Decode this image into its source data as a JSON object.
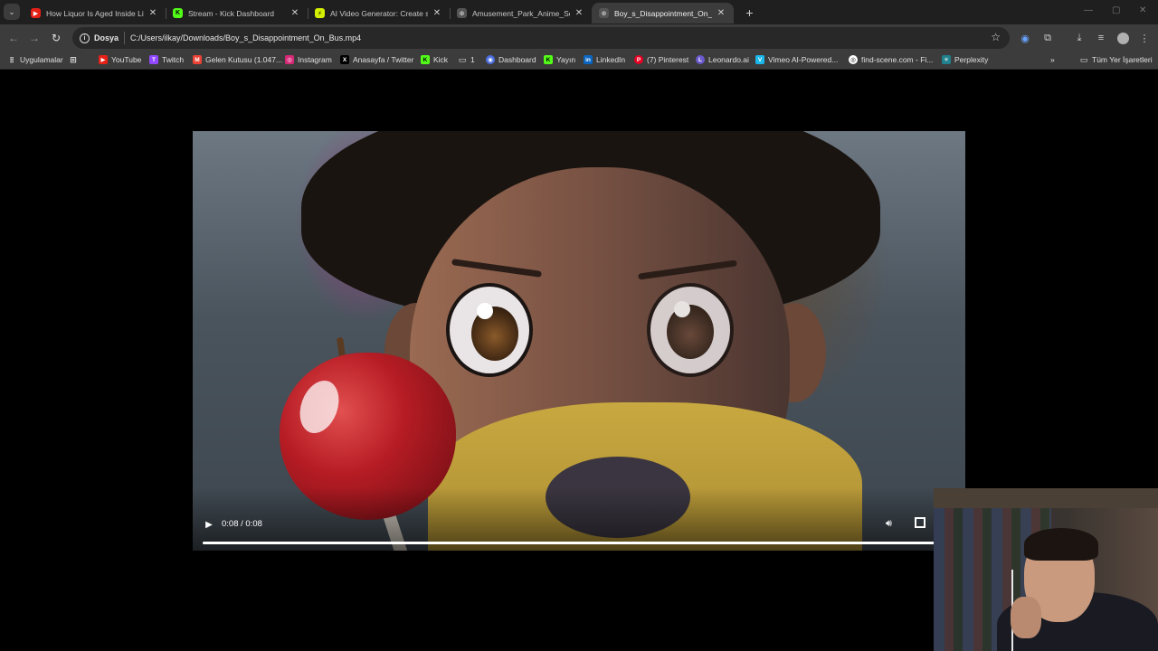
{
  "tabs": [
    {
      "title": "How Liquor Is Aged Inside Living",
      "favicon_color": "#e62117",
      "favicon_glyph": "▶",
      "active": false
    },
    {
      "title": "Stream - Kick Dashboard",
      "favicon_color": "#53fc18",
      "favicon_glyph": "K",
      "active": false
    },
    {
      "title": "AI Video Generator: Create stu",
      "favicon_color": "#d4f000",
      "favicon_glyph": "⚡",
      "active": false
    },
    {
      "title": "Amusement_Park_Anime_Scene",
      "favicon_color": "#555555",
      "favicon_glyph": "⊕",
      "active": false
    },
    {
      "title": "Boy_s_Disappointment_On_Bus",
      "favicon_color": "#555555",
      "favicon_glyph": "⊕",
      "active": true
    }
  ],
  "address_bar": {
    "scheme_label": "Dosya",
    "url": "C:/Users/ilkay/Downloads/Boy_s_Disappointment_On_Bus.mp4"
  },
  "bookmarks": {
    "apps_label": "Uygulamalar",
    "items": [
      {
        "label": "YouTube",
        "color": "#e62117",
        "glyph": "▶"
      },
      {
        "label": "Twitch",
        "color": "#9146ff",
        "glyph": "T"
      },
      {
        "label": "Gelen Kutusu (1.047...",
        "color": "#ea4335",
        "glyph": "M"
      },
      {
        "label": "Instagram",
        "color": "#d62976",
        "glyph": "◎"
      },
      {
        "label": "Anasayfa / Twitter",
        "color": "#000000",
        "glyph": "X"
      },
      {
        "label": "Kick",
        "color": "#53fc18",
        "glyph": "K"
      },
      {
        "label": "1",
        "color": "#3c3c3c",
        "glyph": "▭"
      },
      {
        "label": "Dashboard",
        "color": "#4a6ee0",
        "glyph": "◉"
      },
      {
        "label": "Yayın",
        "color": "#53fc18",
        "glyph": "K"
      },
      {
        "label": "LinkedIn",
        "color": "#0a66c2",
        "glyph": "in"
      },
      {
        "label": "(7) Pinterest",
        "color": "#e60023",
        "glyph": "P"
      },
      {
        "label": "Leonardo.ai",
        "color": "#6a5acd",
        "glyph": "L"
      },
      {
        "label": "Vimeo AI-Powered...",
        "color": "#1ab7ea",
        "glyph": "V"
      },
      {
        "label": "find-scene.com - Fi...",
        "color": "#ffffff",
        "glyph": "◎"
      },
      {
        "label": "Perplexity",
        "color": "#20808d",
        "glyph": "✳"
      }
    ],
    "all_bookmarks_label": "Tüm Yer İşaretleri"
  },
  "video": {
    "time_display": "0:08 / 0:08",
    "progress": 1.0
  }
}
